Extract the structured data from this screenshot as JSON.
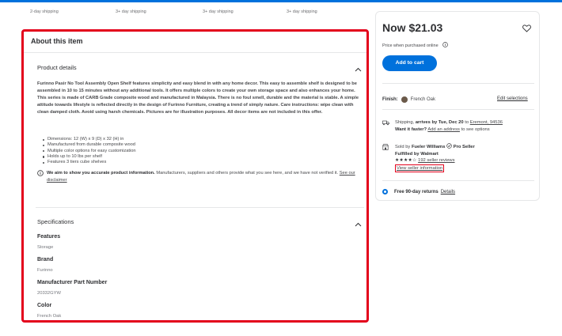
{
  "shipping_options": [
    "2-day shipping",
    "3+ day shipping",
    "3+ day shipping",
    "3+ day shipping"
  ],
  "about": {
    "title": "About this item",
    "product_details": {
      "heading": "Product details",
      "description": "Furinno Pasir No Tool Assembly Open Shelf features simplicity and easy blend in with any home decor. This easy to assemble shelf is designed to be assembled in 10 to 15 minutes without any additional tools. It offers multiple colors to create your own storage space and also enhances your home. This series is made of CARB Grade composite wood and manufactured in Malaysia. There is no foul smell, durable and the material is stable. A simple attitude towards lifestyle is reflected directly in the design of Furinno Furniture, creating a trend of simply nature. Care instructions: wipe clean with clean damped cloth. Avoid using harsh chemicals. Pictures are for illustration purposes. All decor items are not included in this offer.",
      "bullets": [
        "Dimensions: 12 (W) x 9 (D) x 32 (H) in",
        "Manufactured from durable composite wood",
        "Multiple color options for easy customization",
        "Holds up to 10 lbs per shelf",
        "Features 3 tiers cube shelves"
      ],
      "notice_bold": "We aim to show you accurate product information.",
      "notice_text": "Manufacturers, suppliers and others provide what you see here, and we have not verified it.",
      "notice_link": "See our disclaimer"
    },
    "specifications": {
      "heading": "Specifications",
      "items": [
        {
          "label": "Features",
          "value": "Storage"
        },
        {
          "label": "Brand",
          "value": "Furinno"
        },
        {
          "label": "Manufacturer Part Number",
          "value": "20332GYW"
        },
        {
          "label": "Color",
          "value": "French Oak"
        }
      ]
    }
  },
  "buybox": {
    "price": "Now $21.03",
    "price_note": "Price when purchased online",
    "add_to_cart": "Add to cart",
    "finish_label": "Finish:",
    "finish_value": "French Oak",
    "swatch_color": "#6b5a4a",
    "edit_selections": "Edit selections",
    "shipping_prefix": "Shipping,",
    "shipping_arrives": "arrives by Tue, Dec 20",
    "shipping_to": "to",
    "shipping_location": "Eremont, 94536",
    "faster_bold": "Want it faster?",
    "faster_link": "Add an address",
    "faster_suffix": "to see options",
    "sold_by_prefix": "Sold by",
    "seller_name": "Fueler Williams",
    "pro_seller": "Pro Seller",
    "fulfilled_by": "Fulfilled by Walmart",
    "stars": "★★★★☆",
    "reviews": "192 seller reviews",
    "view_seller": "View seller information",
    "returns_bold": "Free 90-day returns",
    "returns_link": "Details"
  },
  "colors": {
    "accent": "#0071dc",
    "highlight": "#e3001b"
  }
}
